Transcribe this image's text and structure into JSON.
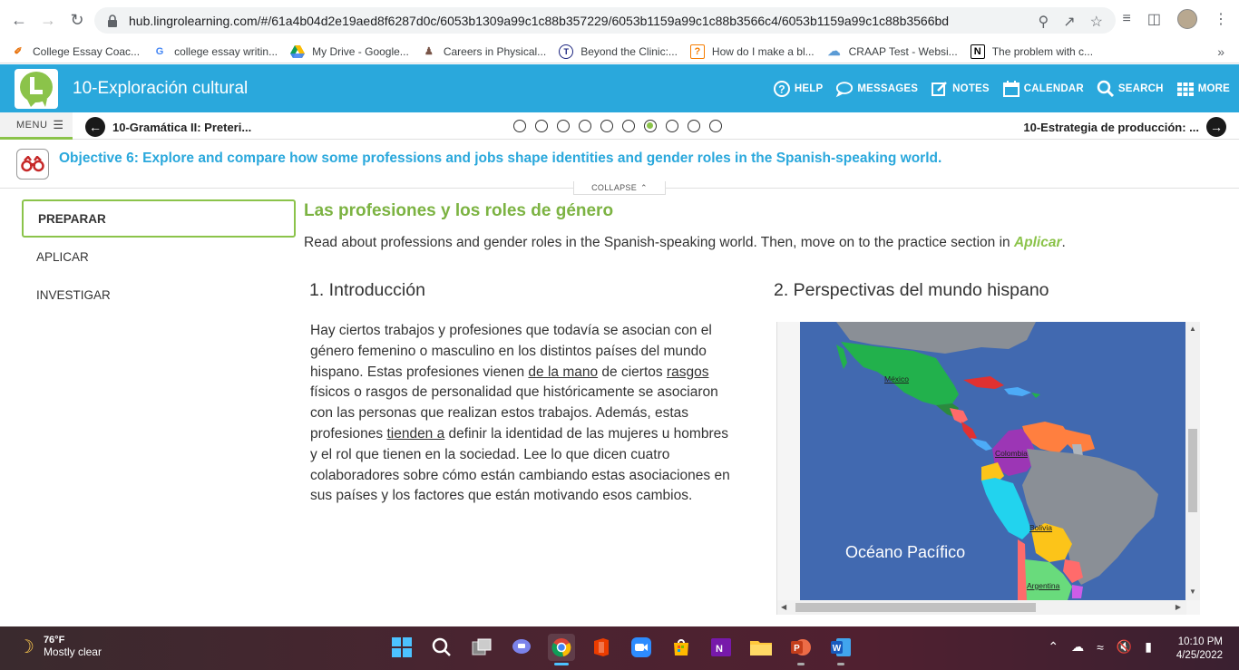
{
  "browser": {
    "url": "hub.lingrolearning.com/#/61a4b04d2e19aed8f6287d0c/6053b1309a99c1c88b357229/6053b1159a99c1c88b3566c4/6053b1159a99c1c88b3566bd",
    "bookmarks": [
      {
        "label": "College Essay Coac...",
        "icon": "pen-icon",
        "color": "#e8710a"
      },
      {
        "label": "college essay writin...",
        "icon": "google-icon",
        "color": "#4285f4"
      },
      {
        "label": "My Drive - Google...",
        "icon": "drive-icon",
        "color": "#0f9d58"
      },
      {
        "label": "Careers in Physical...",
        "icon": "figure-icon",
        "color": "#795548"
      },
      {
        "label": "Beyond the Clinic:...",
        "icon": "clinic-icon",
        "color": "#1a237e"
      },
      {
        "label": "How do I make a bl...",
        "icon": "question-icon",
        "color": "#f57c00"
      },
      {
        "label": "CRAAP Test - Websi...",
        "icon": "cloud-icon",
        "color": "#5b9bd5"
      },
      {
        "label": "The problem with c...",
        "icon": "notion-icon",
        "color": "#000000"
      }
    ]
  },
  "app": {
    "title": "10-Exploración cultural",
    "menu": {
      "help": "HELP",
      "messages": "MESSAGES",
      "notes": "NOTES",
      "calendar": "CALENDAR",
      "search": "SEARCH",
      "more": "MORE"
    },
    "accent": "#2aa8dc",
    "green": "#8bc34a"
  },
  "subnav": {
    "menu_label": "MENU",
    "prev_label": "10-Gramática II: Preteri...",
    "next_label": "10-Estrategia de producción: ...",
    "dots_total": 10,
    "dots_active": 7
  },
  "objective": {
    "text": "Objective 6: Explore and compare how some professions and jobs shape identities and gender roles in the Spanish-speaking world.",
    "collapse_label": "COLLAPSE"
  },
  "leftnav": {
    "items": [
      {
        "label": "PREPARAR",
        "active": true
      },
      {
        "label": "APLICAR",
        "active": false
      },
      {
        "label": "INVESTIGAR",
        "active": false
      }
    ]
  },
  "main": {
    "heading": "Las profesiones y los roles de género",
    "intro_before": "Read about professions and gender roles in the Spanish-speaking world. Then, move on to the practice section in ",
    "intro_link": "Aplicar",
    "intro_after": ".",
    "section1": {
      "title": "1. Introducción",
      "p1": "Hay ciertos trabajos y profesiones que todavía se asocian con el género femenino o masculino en los distintos países del mundo hispano. Estas profesiones vienen ",
      "u1": "de la mano",
      "p2": " de ciertos ",
      "u2": "rasgos ",
      "p3": "físicos o rasgos de personalidad que históricamente se asociaron con las personas que realizan estos trabajos. Además, estas profesiones ",
      "u3": "tienden a",
      "p4": " definir la identidad de las mujeres u hombres y el rol que tienen en la sociedad. Lee lo que dicen cuatro colaboradores sobre cómo están cambiando estas asociaciones en sus países y los factores que están motivando esos cambios."
    },
    "section2": {
      "title": "2. Perspectivas del mundo hispano",
      "map_labels": {
        "mexico": "México",
        "colombia": "Colombia",
        "bolivia": "Bolivia",
        "argentina": "Argentina",
        "ocean": "Océano Pacífico"
      }
    }
  },
  "taskbar": {
    "temp": "76°F",
    "weather": "Mostly clear",
    "time": "10:10 PM",
    "date": "4/25/2022"
  }
}
